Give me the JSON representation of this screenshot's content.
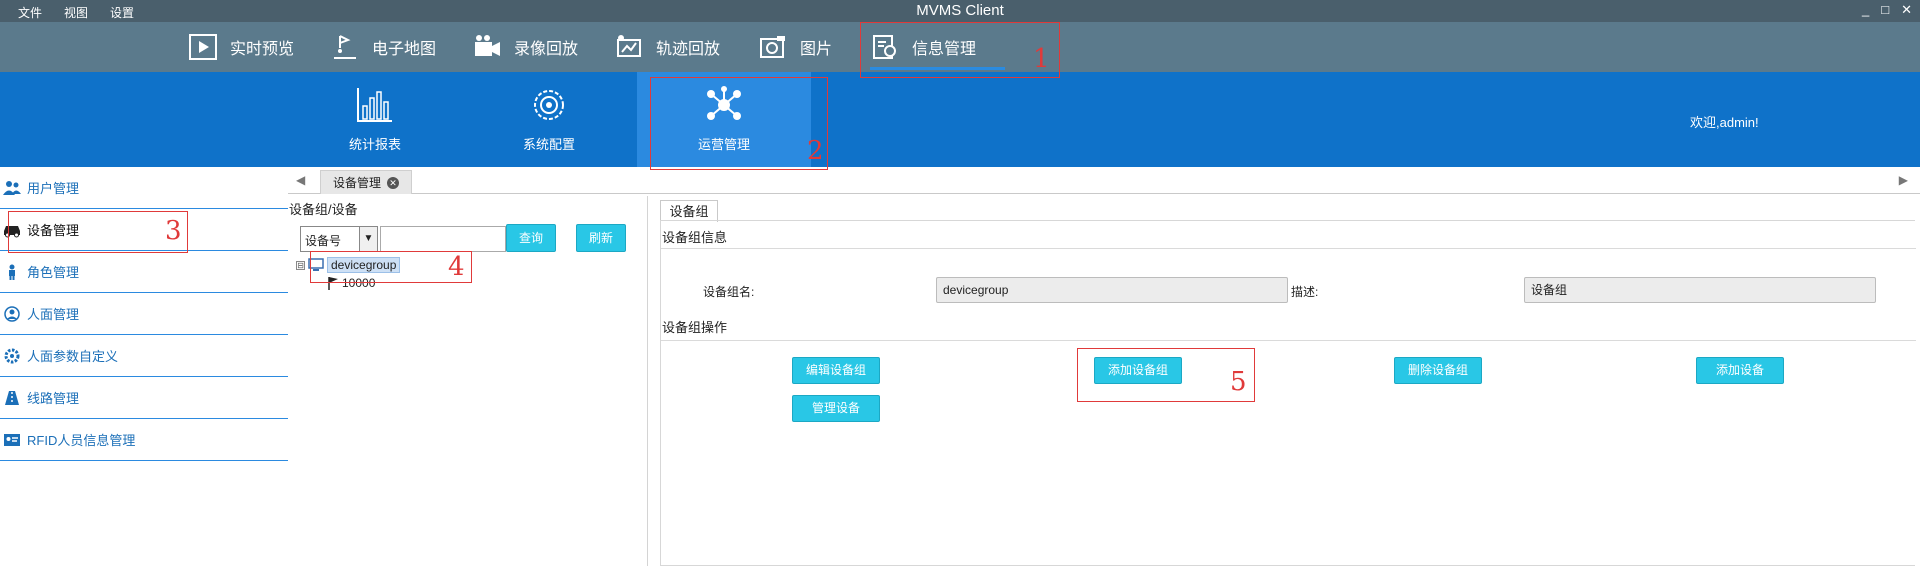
{
  "window": {
    "title": "MVMS Client",
    "menu": [
      "文件",
      "视图",
      "设置"
    ],
    "controls": {
      "minimize": "_",
      "maximize": "□",
      "close": "✕"
    }
  },
  "topnav": {
    "items": [
      {
        "label": "实时预览",
        "icon": "play-icon"
      },
      {
        "label": "电子地图",
        "icon": "map-pin-icon"
      },
      {
        "label": "录像回放",
        "icon": "video-camera-icon"
      },
      {
        "label": "轨迹回放",
        "icon": "track-icon"
      },
      {
        "label": "图片",
        "icon": "picture-icon"
      },
      {
        "label": "信息管理",
        "icon": "info-management-icon"
      }
    ],
    "active_index": 5
  },
  "subnav": {
    "items": [
      {
        "label": "统计报表",
        "icon": "bar-chart-icon"
      },
      {
        "label": "系统配置",
        "icon": "gear-icon"
      },
      {
        "label": "运营管理",
        "icon": "network-icon"
      }
    ],
    "active_index": 2,
    "welcome": "欢迎,admin!"
  },
  "sidebar": {
    "items": [
      {
        "label": "用户管理",
        "icon": "users-icon"
      },
      {
        "label": "设备管理",
        "icon": "car-icon"
      },
      {
        "label": "角色管理",
        "icon": "person-icon"
      },
      {
        "label": "人面管理",
        "icon": "face-icon"
      },
      {
        "label": "人面参数自定义",
        "icon": "gear-icon"
      },
      {
        "label": "线路管理",
        "icon": "route-icon"
      },
      {
        "label": "RFID人员信息管理",
        "icon": "id-card-icon"
      }
    ],
    "active_index": 1
  },
  "tabstrip": {
    "tab_label": "设备管理",
    "left_arrow": "◀",
    "right_arrow": "▶",
    "close": "✕"
  },
  "tree_panel": {
    "title": "设备组/设备",
    "filter_select": "设备号",
    "filter_select_arrow": "▼",
    "search_value": "",
    "query_button": "查询",
    "refresh_button": "刷新",
    "tree": {
      "root": {
        "label": "devicegroup",
        "expander": "⊟"
      },
      "children": [
        {
          "label": "10000"
        }
      ]
    }
  },
  "right_panel": {
    "tab_label": "设备组",
    "info_section": "设备组信息",
    "group_name_label": "设备组名:",
    "group_name_value": "devicegroup",
    "desc_label": "描述:",
    "desc_value": "设备组",
    "ops_section": "设备组操作",
    "buttons": {
      "edit_group": "编辑设备组",
      "add_group": "添加设备组",
      "delete_group": "删除设备组",
      "add_device": "添加设备",
      "manage_device": "管理设备"
    }
  },
  "annotations": [
    "1",
    "2",
    "3",
    "4",
    "5"
  ],
  "colors": {
    "titlebar": "#4a5f6c",
    "topnav": "#5b7a8c",
    "subnav": "#0f72c9",
    "subnav_active": "#2b8ae0",
    "button": "#29c7e6",
    "annotation": "#e03a3a"
  }
}
